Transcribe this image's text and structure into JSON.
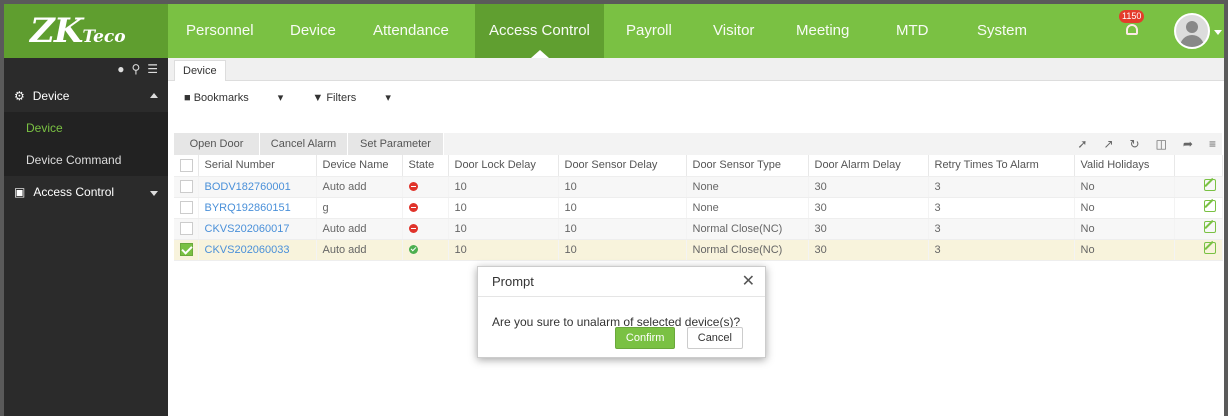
{
  "app": {
    "logo_main": "ZK",
    "logo_sub": "Teco"
  },
  "nav": {
    "items": [
      "Personnel",
      "Device",
      "Attendance",
      "Access Control",
      "Payroll",
      "Visitor",
      "Meeting",
      "MTD",
      "System"
    ],
    "active": "Access Control",
    "notification_count": "1150"
  },
  "sidebar": {
    "groups": [
      {
        "label": "Device",
        "items": [
          "Device",
          "Device Command"
        ],
        "active_item": "Device"
      },
      {
        "label": "Access Control"
      }
    ]
  },
  "tab": {
    "label": "Device"
  },
  "filters": {
    "bookmarks": "Bookmarks",
    "filters": "Filters"
  },
  "toolbar": {
    "buttons": [
      "Open Door",
      "Cancel Alarm",
      "Set Parameter"
    ]
  },
  "table": {
    "columns": [
      "Serial Number",
      "Device Name",
      "State",
      "Door Lock Delay",
      "Door Sensor Delay",
      "Door Sensor Type",
      "Door Alarm Delay",
      "Retry Times To Alarm",
      "Valid Holidays"
    ],
    "rows": [
      {
        "serial": "BODV182760001",
        "name": "Auto add",
        "state": "offline",
        "lock_delay": "10",
        "sensor_delay": "10",
        "sensor_type": "None",
        "alarm_delay": "30",
        "retry": "3",
        "holidays": "No",
        "selected": false
      },
      {
        "serial": "BYRQ192860151",
        "name": "g",
        "state": "offline",
        "lock_delay": "10",
        "sensor_delay": "10",
        "sensor_type": "None",
        "alarm_delay": "30",
        "retry": "3",
        "holidays": "No",
        "selected": false
      },
      {
        "serial": "CKVS202060017",
        "name": "Auto add",
        "state": "offline",
        "lock_delay": "10",
        "sensor_delay": "10",
        "sensor_type": "Normal Close(NC)",
        "alarm_delay": "30",
        "retry": "3",
        "holidays": "No",
        "selected": false
      },
      {
        "serial": "CKVS202060033",
        "name": "Auto add",
        "state": "online",
        "lock_delay": "10",
        "sensor_delay": "10",
        "sensor_type": "Normal Close(NC)",
        "alarm_delay": "30",
        "retry": "3",
        "holidays": "No",
        "selected": true
      }
    ]
  },
  "modal": {
    "title": "Prompt",
    "message": "Are you sure to unalarm of selected device(s)?",
    "confirm_label": "Confirm",
    "cancel_label": "Cancel"
  },
  "colors": {
    "brand": "#7ac143",
    "brand_dark": "#5f9e2f",
    "sidebar": "#2b2b2b",
    "danger": "#e0332a",
    "ok": "#4caf50"
  }
}
